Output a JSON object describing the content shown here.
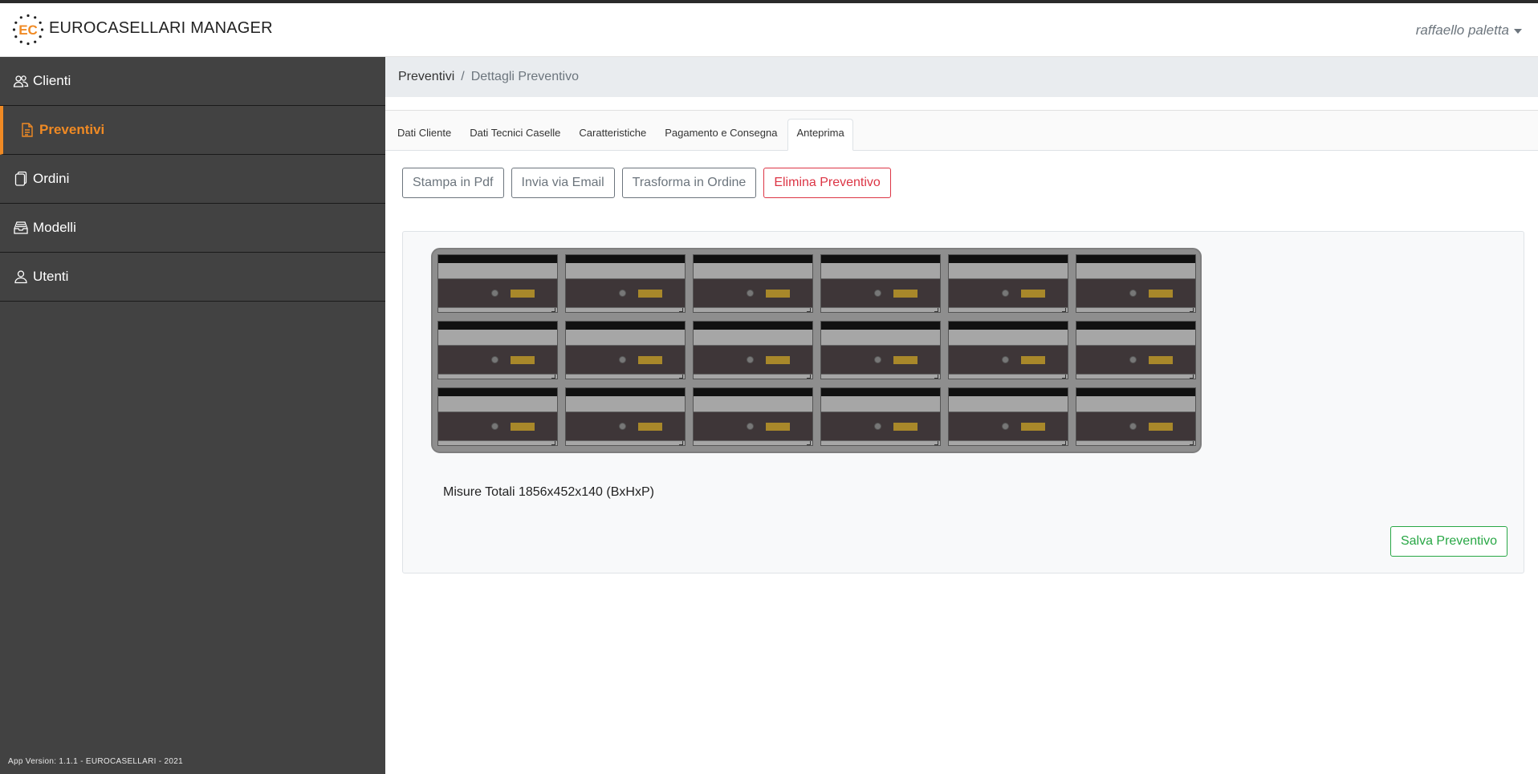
{
  "navbar": {
    "brand": "EUROCASELLARI MANAGER",
    "logo_text": "EC",
    "logo_icon": "eurocasellari-logo",
    "user_name": "raffaello paletta"
  },
  "sidebar": {
    "items": [
      {
        "label": "Clienti",
        "icon": "users-icon",
        "active": false
      },
      {
        "label": "Preventivi",
        "icon": "document-icon",
        "active": true
      },
      {
        "label": "Ordini",
        "icon": "copy-icon",
        "active": false
      },
      {
        "label": "Modelli",
        "icon": "inbox-icon",
        "active": false
      },
      {
        "label": "Utenti",
        "icon": "user-icon",
        "active": false
      }
    ],
    "app_version": "App Version: 1.1.1 - EUROCASELLARI - 2021",
    "accent_color": "#f08a24"
  },
  "breadcrumb": {
    "parent": "Preventivi",
    "separator": "/",
    "current": "Dettagli Preventivo"
  },
  "tabs": [
    {
      "label": "Dati Cliente",
      "active": false
    },
    {
      "label": "Dati Tecnici Caselle",
      "active": false
    },
    {
      "label": "Caratteristiche",
      "active": false
    },
    {
      "label": "Pagamento e Consegna",
      "active": false
    },
    {
      "label": "Anteprima",
      "active": true
    }
  ],
  "actions": {
    "pdf": "Stampa in Pdf",
    "email": "Invia via Email",
    "order": "Trasforma in Ordine",
    "delete": "Elimina Preventivo"
  },
  "preview": {
    "rows": 3,
    "columns": 6,
    "measures": "Misure Totali 1856x452x140 (BxHxP)"
  },
  "save_label": "Salva Preventivo"
}
